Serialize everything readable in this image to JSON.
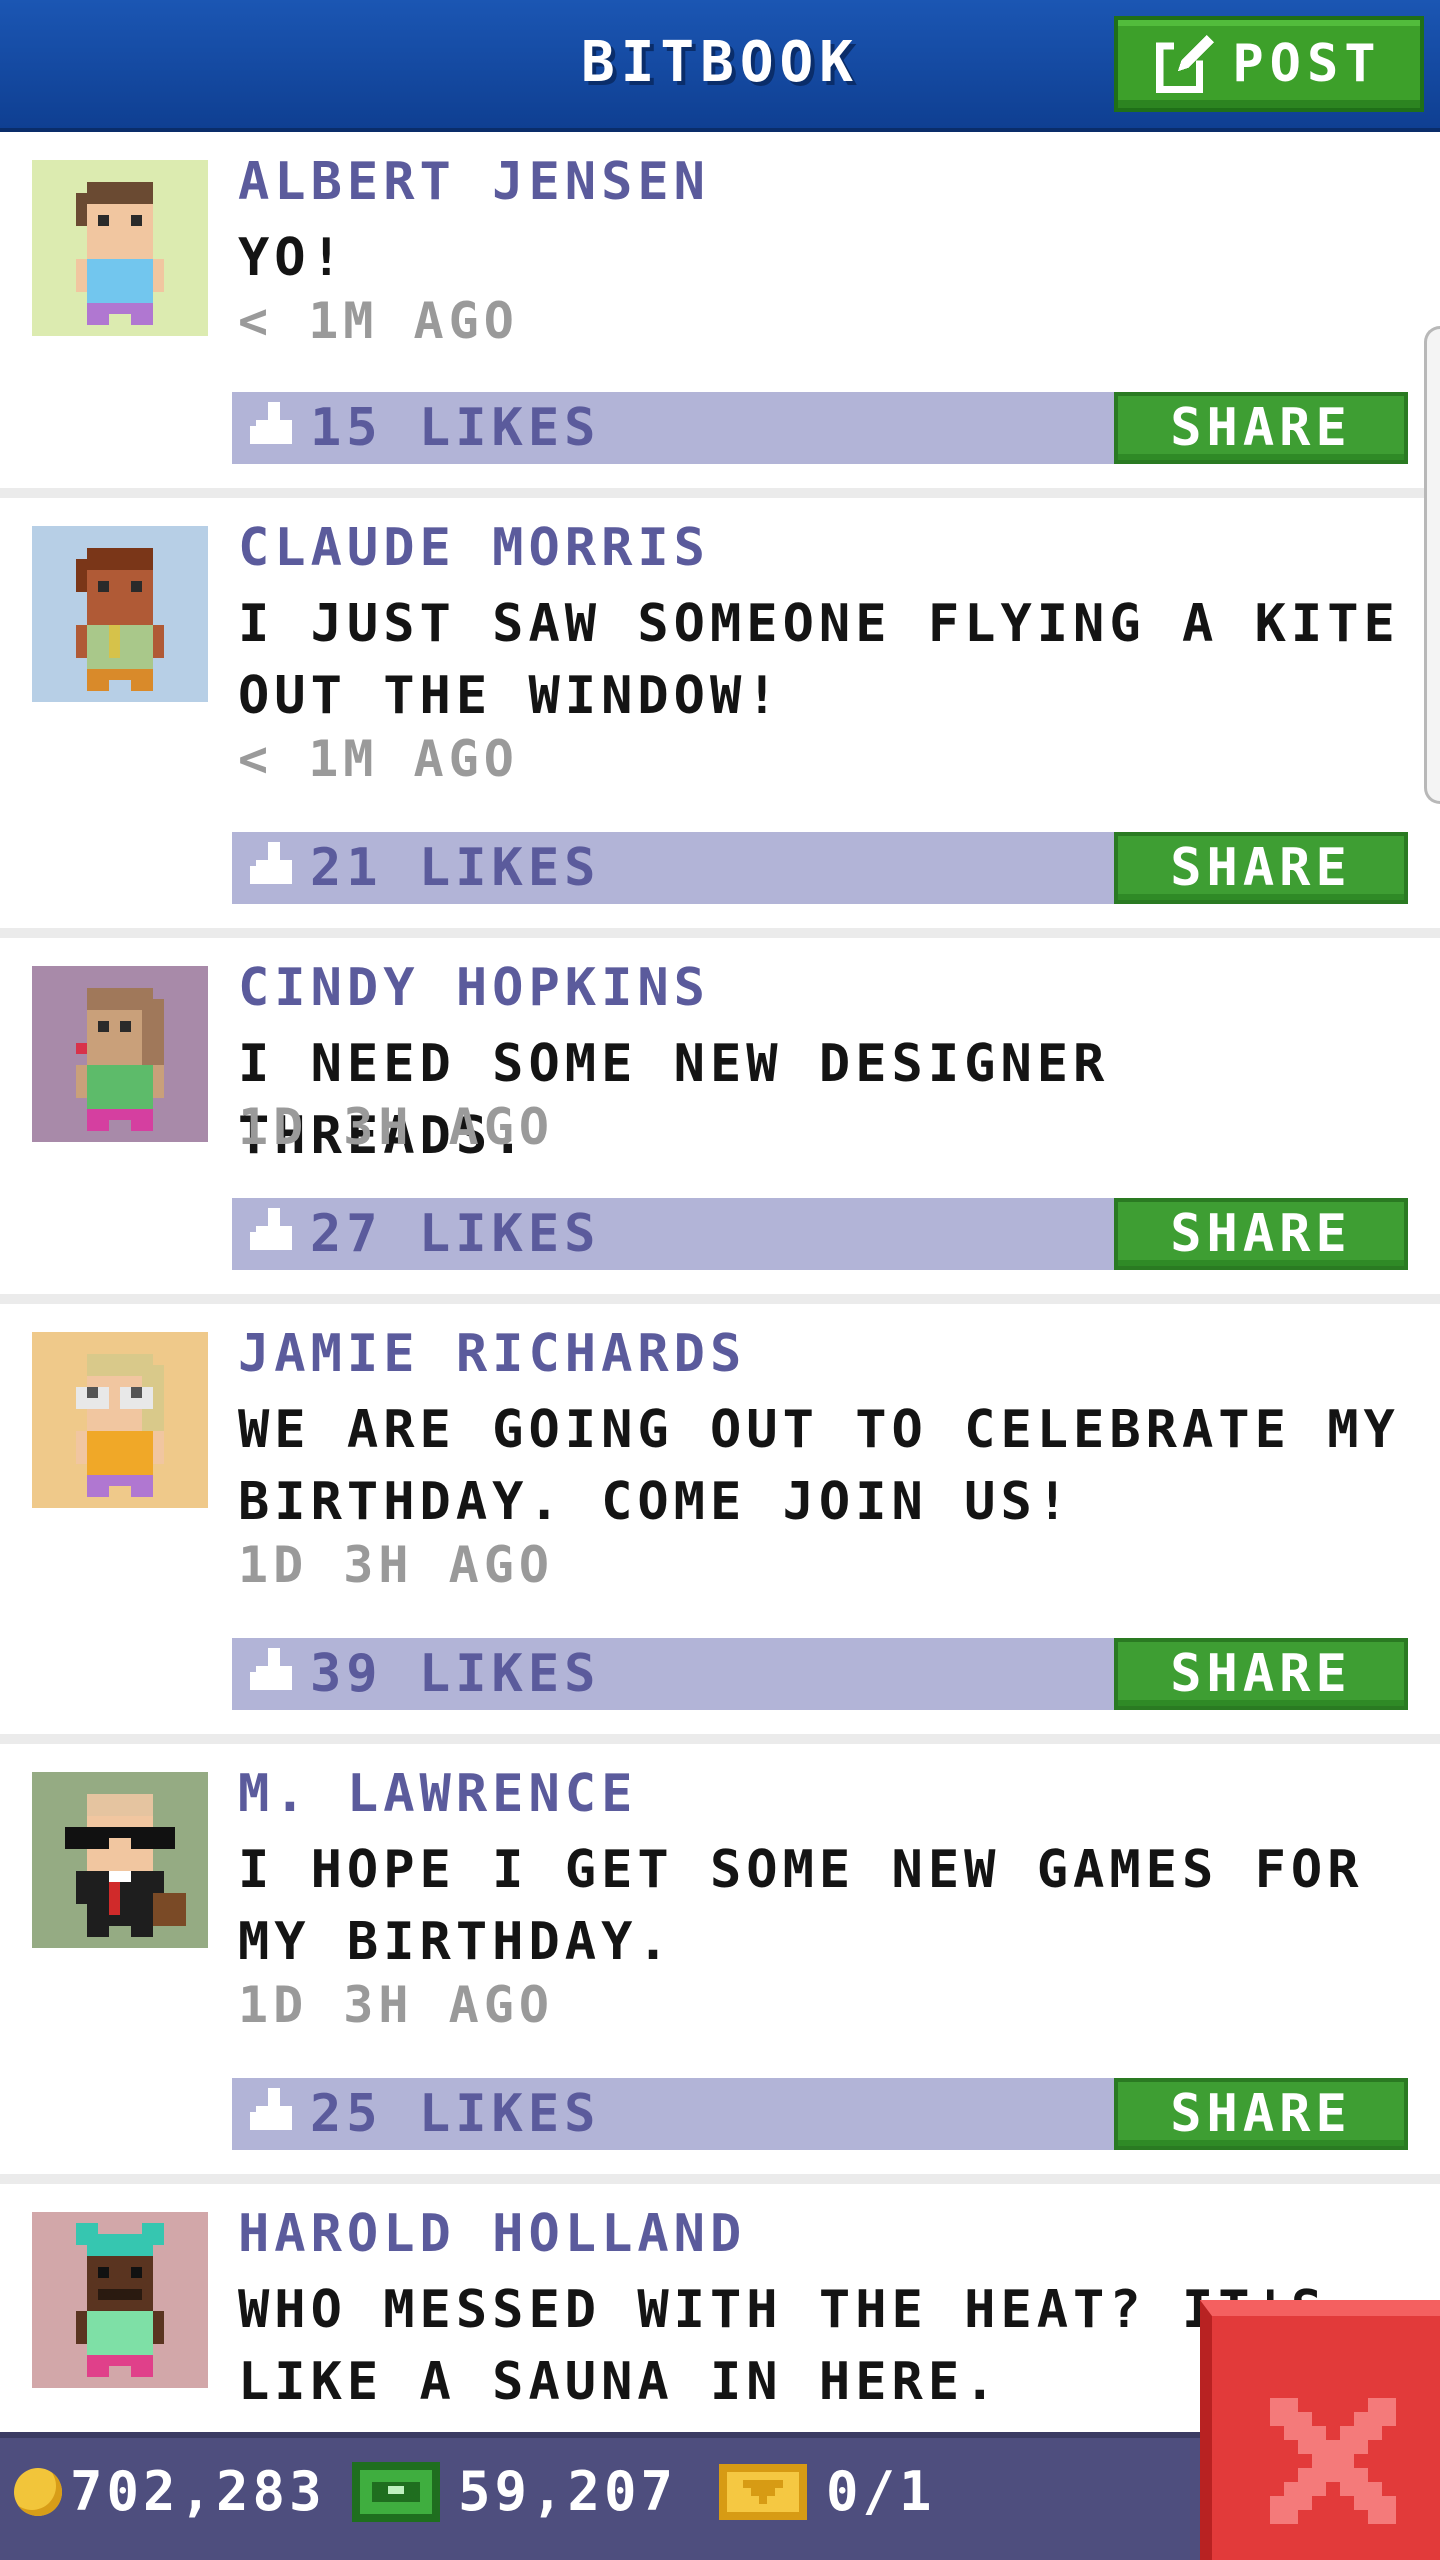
{
  "header": {
    "title": "BITBOOK",
    "post_label": "POST"
  },
  "feed": [
    {
      "author": "ALBERT JENSEN",
      "message": "YO!",
      "time": "< 1M AGO",
      "likes": "15 LIKES",
      "share_label": "SHARE",
      "avatar_bg": "#dcebb0"
    },
    {
      "author": "CLAUDE MORRIS",
      "message": "I JUST SAW SOMEONE FLYING A KITE OUT THE WINDOW!",
      "time": "< 1M AGO",
      "likes": "21 LIKES",
      "share_label": "SHARE",
      "avatar_bg": "#b7cfe6"
    },
    {
      "author": "CINDY HOPKINS",
      "message": "I NEED SOME NEW DESIGNER THREADS.",
      "time": "1D 3H AGO",
      "likes": "27 LIKES",
      "share_label": "SHARE",
      "avatar_bg": "#a88aa9"
    },
    {
      "author": "JAMIE RICHARDS",
      "message": "WE ARE GOING OUT TO CELEBRATE MY BIRTHDAY. COME JOIN US!",
      "time": "1D 3H AGO",
      "likes": "39 LIKES",
      "share_label": "SHARE",
      "avatar_bg": "#efc98a"
    },
    {
      "author": "M. LAWRENCE",
      "message": "I HOPE I GET SOME NEW GAMES FOR MY BIRTHDAY.",
      "time": "1D 3H AGO",
      "likes": "25 LIKES",
      "share_label": "SHARE",
      "avatar_bg": "#95ab83"
    },
    {
      "author": "HAROLD HOLLAND",
      "message": "WHO MESSED WITH THE HEAT? IT'S LIKE A SAUNA IN HERE.",
      "avatar_bg": "#d2a7a9"
    }
  ],
  "footer": {
    "coins": "702,283",
    "bux": "59,207",
    "vip": "0/1"
  },
  "colors": {
    "header_blue": "#1b56b3",
    "accent_green": "#3e9e33",
    "like_bar": "#b2b4d7",
    "name_purple": "#5b5b9c",
    "close_red": "#e23a3a"
  },
  "icons": [
    "post-edit-icon",
    "thumbs-up-icon",
    "coin-icon",
    "bux-icon",
    "vip-ticket-icon",
    "close-x-icon"
  ]
}
